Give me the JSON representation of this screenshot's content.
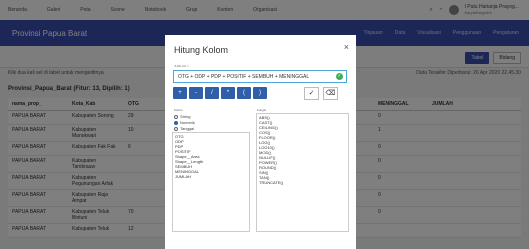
{
  "topnav": {
    "items": [
      "Beranda",
      "Galeri",
      "Peta",
      "Scene",
      "Notebook",
      "Grup",
      "Konten",
      "Organisasi"
    ],
    "user_name": "I Putu Harianja Prayog...",
    "user_role": "Karya/Keypoint"
  },
  "titlebar": {
    "title": "Provinsi Papua Barat",
    "tabs": [
      "Tinjauan",
      "Data",
      "Visualisasi",
      "Penggunaan",
      "Pengaturan"
    ]
  },
  "subbar": {
    "buttons": [
      "Tabel",
      "Bidang"
    ]
  },
  "info": {
    "message": "Klik dua kali sel di tabel untuk mengeditnya",
    "updated": "Data Terakhir Diperbarui: 26 Apr 2020 22.45.30"
  },
  "table": {
    "title": "Provinsi_Papua_Barat (Fitur: 13, Dipilih: 1)",
    "columns": [
      "nama_prop_",
      "Kota_Kab",
      "OTG",
      "",
      "",
      "",
      "",
      "MENINGGAL",
      "JUMLAH"
    ],
    "rows": [
      [
        "PAPUA BARAT",
        "Kabupaten Sorong",
        "29",
        "",
        "",
        "",
        "",
        "0",
        ""
      ],
      [
        "PAPUA BARAT",
        "Kabupaten Manokwari",
        "10",
        "",
        "",
        "",
        "",
        "1",
        ""
      ],
      [
        "PAPUA BARAT",
        "Kabupaten Fak Fak",
        "6",
        "",
        "",
        "",
        "",
        "0",
        ""
      ],
      [
        "PAPUA BARAT",
        "Kabupaten Tambrauw",
        "",
        "",
        "",
        "",
        "",
        "0",
        ""
      ],
      [
        "PAPUA BARAT",
        "Kabupaten Pegunungan Arfak",
        "",
        "",
        "",
        "",
        "",
        "0",
        ""
      ],
      [
        "PAPUA BARAT",
        "Kabupaten Raja Ampat",
        "",
        "",
        "",
        "",
        "",
        "0",
        ""
      ],
      [
        "PAPUA BARAT",
        "Kabupaten Teluk Bintuni",
        "70",
        "",
        "",
        "",
        "",
        "0",
        ""
      ],
      [
        "PAPUA BARAT",
        "Kabupaten Teluk",
        "12",
        "",
        "",
        "",
        "",
        "",
        ""
      ]
    ]
  },
  "modal": {
    "title": "Hitung Kolom",
    "close": "×",
    "field_label": "JUMLAH =",
    "formula": "OTG + ODP + PDP + POSITIF + SEMBUH + MENINGGAL",
    "valid_mark": "✓",
    "operators": [
      "+",
      "-",
      "/",
      "*",
      "(",
      ")"
    ],
    "check_icon": "✓",
    "clear_icon": "⌫",
    "kolom_title": "Kolom",
    "radios": [
      {
        "label": "String",
        "checked": false
      },
      {
        "label": "Numerik",
        "checked": true
      },
      {
        "label": "Tanggal",
        "checked": false
      }
    ],
    "columns": [
      "OTG",
      "ODP",
      "PDP",
      "POSITIF",
      "Shape__Area",
      "Shape__Length",
      "SEMBUH",
      "MENINGGAL",
      "JUMLAH"
    ],
    "fungsi_title": "Fungsi",
    "functions": [
      "ABS()",
      "CAST()",
      "CEILING()",
      "COS()",
      "FLOOR()",
      "LOG()",
      "LOG10()",
      "MOD()",
      "NULLIF()",
      "POWER()",
      "ROUND()",
      "SIN()",
      "TAN()",
      "TRUNCATE()"
    ]
  }
}
